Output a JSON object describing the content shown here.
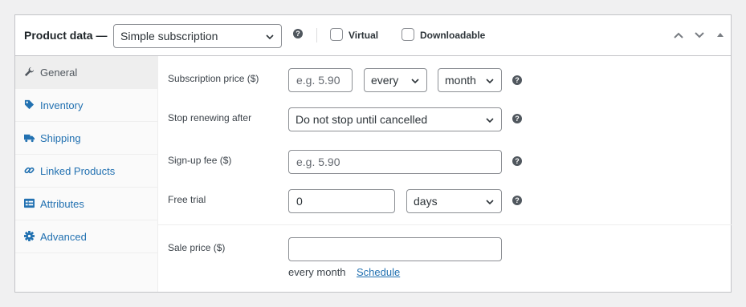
{
  "header": {
    "title": "Product data —",
    "product_type": "Simple subscription",
    "help_glyph": "?",
    "virtual_label": "Virtual",
    "downloadable_label": "Downloadable",
    "virtual_checked": false,
    "downloadable_checked": false
  },
  "sidebar": {
    "items": [
      {
        "label": "General",
        "icon": "wrench-icon",
        "active": true
      },
      {
        "label": "Inventory",
        "icon": "tag-icon",
        "active": false
      },
      {
        "label": "Shipping",
        "icon": "truck-icon",
        "active": false
      },
      {
        "label": "Linked Products",
        "icon": "link-icon",
        "active": false
      },
      {
        "label": "Attributes",
        "icon": "list-icon",
        "active": false
      },
      {
        "label": "Advanced",
        "icon": "gear-icon",
        "active": false
      }
    ]
  },
  "fields": {
    "subscription_price": {
      "label": "Subscription price ($)",
      "placeholder": "e.g. 5.90",
      "interval": "every",
      "period": "month"
    },
    "stop_renewing": {
      "label": "Stop renewing after",
      "value": "Do not stop until cancelled"
    },
    "signup_fee": {
      "label": "Sign-up fee ($)",
      "placeholder": "e.g. 5.90"
    },
    "free_trial": {
      "label": "Free trial",
      "value": "0",
      "unit": "days"
    },
    "sale_price": {
      "label": "Sale price ($)",
      "value": "",
      "note": "every month",
      "schedule_link": "Schedule"
    }
  },
  "colors": {
    "link": "#2271b1",
    "active_tab_bg": "#eeeeee",
    "border": "#c3c4c7"
  }
}
